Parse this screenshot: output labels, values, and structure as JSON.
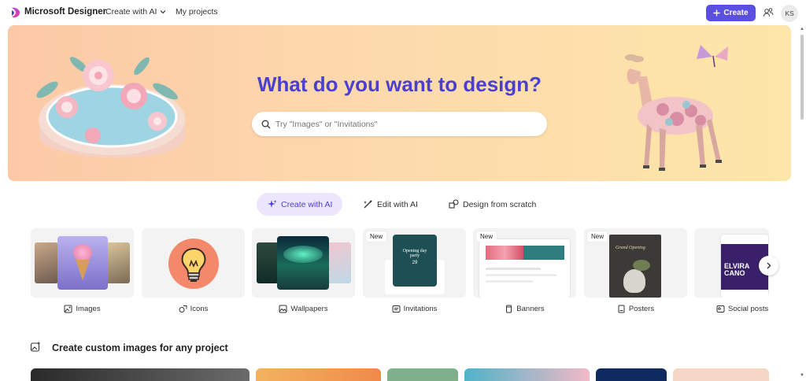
{
  "header": {
    "brand": "Microsoft Designer",
    "nav": {
      "create_with_ai": "Create with AI",
      "my_projects": "My projects"
    },
    "create_button": "Create",
    "avatar_initials": "KS"
  },
  "hero": {
    "title": "What do you want to design?",
    "search_placeholder": "Try \"Images\" or \"Invitations\""
  },
  "tabs": [
    {
      "label": "Create with AI",
      "icon": "sparkle-icon",
      "active": true
    },
    {
      "label": "Edit with AI",
      "icon": "magic-wand-icon",
      "active": false
    },
    {
      "label": "Design from scratch",
      "icon": "shapes-icon",
      "active": false
    }
  ],
  "categories": [
    {
      "label": "Images",
      "icon": "image-icon",
      "new": false
    },
    {
      "label": "Icons",
      "icon": "icon-shape-icon",
      "new": false
    },
    {
      "label": "Wallpapers",
      "icon": "wallpaper-icon",
      "new": false
    },
    {
      "label": "Invitations",
      "icon": "invitation-icon",
      "new": true,
      "badge": "New",
      "card_text": "Opening day party",
      "card_number": "29"
    },
    {
      "label": "Banners",
      "icon": "banner-icon",
      "new": true,
      "badge": "New"
    },
    {
      "label": "Posters",
      "icon": "poster-icon",
      "new": true,
      "badge": "New",
      "card_text": "Grand Opening"
    },
    {
      "label": "Social posts",
      "icon": "social-post-icon",
      "new": false,
      "card_text": "ELVIRA CANO"
    }
  ],
  "section": {
    "title": "Create custom images for any project"
  },
  "colors": {
    "accent": "#5a4fe0",
    "title": "#4b3fd1",
    "tab_active_bg": "#ebe6fb"
  }
}
